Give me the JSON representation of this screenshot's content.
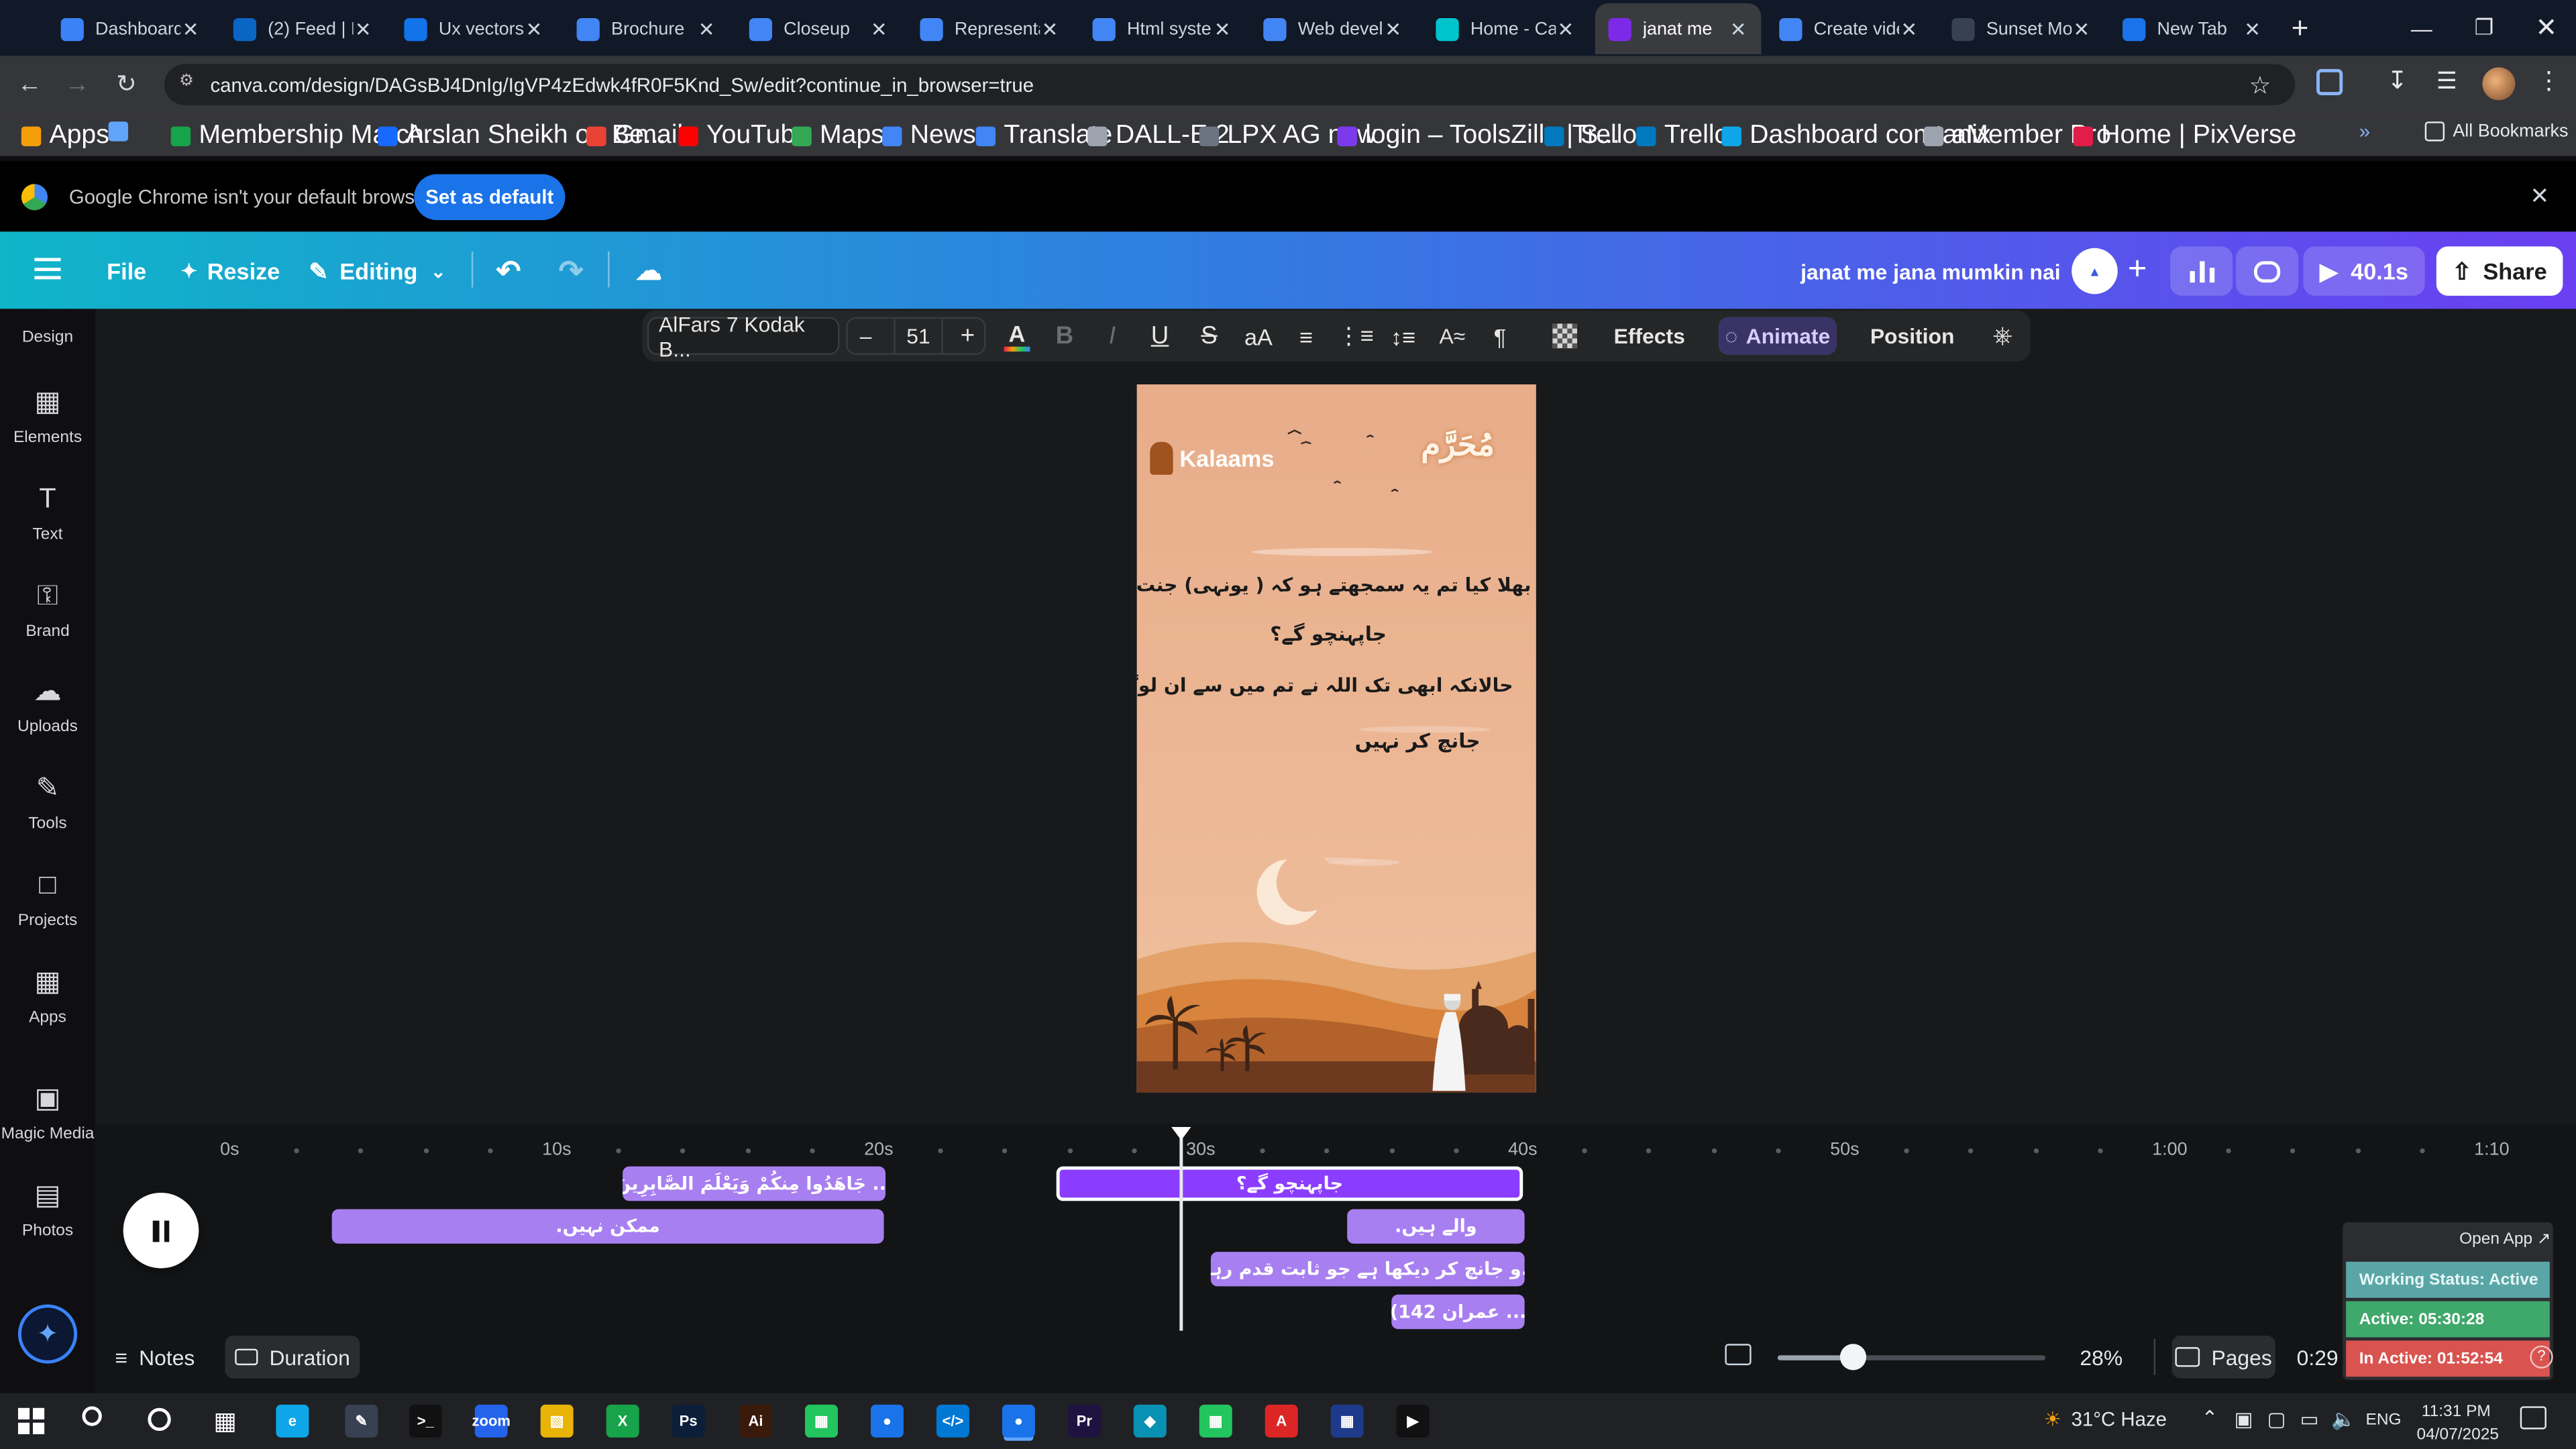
{
  "browser": {
    "tabs": [
      {
        "title": "Dashboard",
        "icon": "dashboard-icon",
        "color": "#3b82f6"
      },
      {
        "title": "(2) Feed | LinkedIn",
        "icon": "linkedin-icon",
        "color": "#0a66c2"
      },
      {
        "title": "Ux vectors",
        "icon": "freepik-icon",
        "color": "#1273eb"
      },
      {
        "title": "Brochure",
        "icon": "docs-icon",
        "color": "#4285f4"
      },
      {
        "title": "Closeup",
        "icon": "docs-icon",
        "color": "#4285f4"
      },
      {
        "title": "Representation",
        "icon": "docs-icon",
        "color": "#4285f4"
      },
      {
        "title": "Html system",
        "icon": "docs-icon",
        "color": "#4285f4"
      },
      {
        "title": "Web development",
        "icon": "docs-icon",
        "color": "#4285f4"
      },
      {
        "title": "Home - Canva",
        "icon": "canva-icon",
        "color": "#00c4cc"
      },
      {
        "title": "janat me",
        "icon": "canva-icon",
        "color": "#7d2ae8"
      },
      {
        "title": "Create video",
        "icon": "docs-icon",
        "color": "#4285f4"
      },
      {
        "title": "Sunset Mosque",
        "icon": "pixverse-icon",
        "color": "#374151"
      },
      {
        "title": "New Tab",
        "icon": "chrome-icon",
        "color": "#1a73e8"
      }
    ],
    "url": "canva.com/design/DAGsBJ4DnIg/IgVP4zEdwk4fR0F5Knd_Sw/edit?continue_in_browser=true",
    "bookmarks": [
      {
        "label": "Apps",
        "color": "#f59e0b"
      },
      {
        "label": "",
        "color": "#60a5fa"
      },
      {
        "label": "Membership March...",
        "color": "#16a34a"
      },
      {
        "label": "Arslan Sheikh on Be...",
        "color": "#1769ff"
      },
      {
        "label": "Gmail",
        "color": "#ea4335"
      },
      {
        "label": "YouTube",
        "color": "#ff0000"
      },
      {
        "label": "Maps",
        "color": "#34a853"
      },
      {
        "label": "News",
        "color": "#4285f4"
      },
      {
        "label": "Translate",
        "color": "#4285f4"
      },
      {
        "label": "DALL-E 2",
        "color": "#9ca3af"
      },
      {
        "label": "LPX AG new",
        "color": "#6b7280"
      },
      {
        "label": "login – ToolsZilla | S...",
        "color": "#7c3aed"
      },
      {
        "label": "Trello",
        "color": "#0079bf"
      },
      {
        "label": "Trello",
        "color": "#0079bf"
      },
      {
        "label": "Dashboard comtanix",
        "color": "#0ea5e9"
      },
      {
        "label": "aMember Pro",
        "color": "#9ca3af"
      },
      {
        "label": "Home | PixVerse",
        "color": "#e11d48"
      }
    ],
    "all_bookmarks": "All Bookmarks",
    "default_msg": "Google Chrome isn't your default browser",
    "set_default": "Set as default"
  },
  "canva": {
    "file": "File",
    "resize": "Resize",
    "editing": "Editing",
    "design_title": "janat me jana mumkin nai",
    "play_time": "40.1s",
    "share": "Share"
  },
  "rail": [
    "Design",
    "Elements",
    "Text",
    "Brand",
    "Uploads",
    "Tools",
    "Projects",
    "Apps",
    "Magic Media",
    "Photos"
  ],
  "toolbar": {
    "font": "AlFars 7 Kodak B...",
    "minus": "–",
    "font_size": "51",
    "plus": "+",
    "effects": "Effects",
    "animate": "Animate",
    "position": "Position"
  },
  "design": {
    "brand": "Kalaams",
    "month": "مُحَرَّم",
    "line1": "بھلا کیا تم یہ سمجھتے ہو کہ ( یونہی) جنت کے اندر",
    "line2": "جاپہنچو گے؟",
    "line3": "حالانکہ ابھی تک اللہ نے تم میں سے ان لوگ",
    "line4": "جانچ کر نہیں",
    "sky_color": "#e9b18f",
    "dune_color": "#d8843e"
  },
  "timeline": {
    "ticks": [
      "0s",
      "10s",
      "20s",
      "30s",
      "40s",
      "50s",
      "1:00",
      "1:10"
    ],
    "clips": [
      {
        "text": "... جَاهَدُوا مِنكُمْ وَيَعْلَمَ الصَّابِرِينَ",
        "selected": false
      },
      {
        "text": "ممکن نہیں.",
        "selected": false
      },
      {
        "text": "جاپہنچو گے؟",
        "selected": true
      },
      {
        "text": "والے ہیں.",
        "selected": false
      },
      {
        "text": "...و جانچ کر دیکھا ہے جو ثابت قدم رہنے",
        "selected": false
      },
      {
        "text": "... عمران 142)",
        "selected": false
      }
    ],
    "notes": "Notes",
    "duration": "Duration",
    "zoom": "28%",
    "zoom_level": 0.28,
    "pages": "Pages",
    "time": "0:29"
  },
  "tracker": {
    "open": "Open App ↗",
    "status": "Working Status: Active",
    "active": "Active: 05:30:28",
    "inactive": "In Active: 01:52:54",
    "active_color": "#3fa86b",
    "inactive_color": "#d9534f"
  },
  "taskbar": {
    "weather": "31°C Haze",
    "lang": "ENG",
    "time": "11:31 PM",
    "date": "04/07/2025"
  }
}
